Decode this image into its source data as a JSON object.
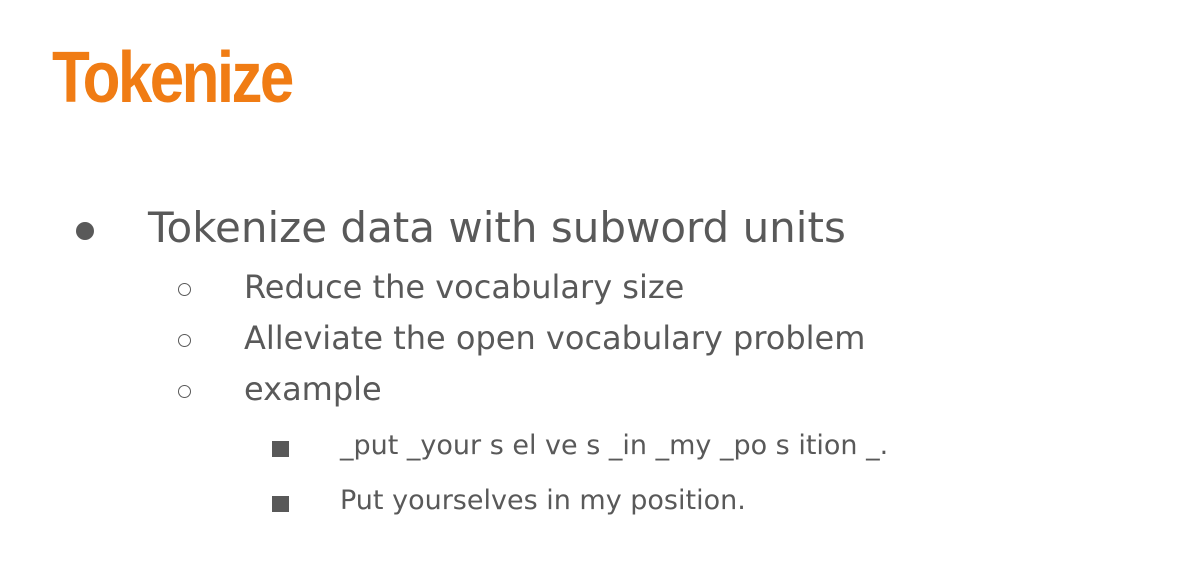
{
  "slide": {
    "title": "Tokenize",
    "title_color": "#f07c14",
    "text_color": "#595959",
    "bullets": [
      {
        "text": "Tokenize data with subword units",
        "children": [
          {
            "text": "Reduce the vocabulary size"
          },
          {
            "text": "Alleviate the open vocabulary problem"
          },
          {
            "text": "example",
            "children": [
              {
                "text": "_put _your s el ve s _in _my _po s ition _."
              },
              {
                "text": "Put yourselves in my position."
              }
            ]
          }
        ]
      }
    ]
  }
}
